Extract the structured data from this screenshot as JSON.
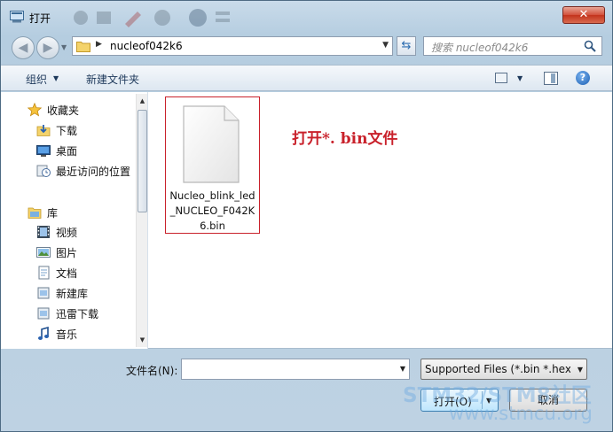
{
  "window": {
    "title": "打开",
    "close_label": "✕"
  },
  "navigation": {
    "address_path": "nucleof042k6",
    "search_placeholder": "搜索 nucleof042k6"
  },
  "toolbar": {
    "organize_label": "组织",
    "new_folder_label": "新建文件夹"
  },
  "sidebar": {
    "favorites_label": "收藏夹",
    "favorites": [
      {
        "label": "下载",
        "icon": "download-folder-icon"
      },
      {
        "label": "桌面",
        "icon": "desktop-icon"
      },
      {
        "label": "最近访问的位置",
        "icon": "recent-places-icon"
      }
    ],
    "libraries_label": "库",
    "libraries": [
      {
        "label": "视频",
        "icon": "video-library-icon"
      },
      {
        "label": "图片",
        "icon": "pictures-library-icon"
      },
      {
        "label": "文档",
        "icon": "documents-library-icon"
      },
      {
        "label": "新建库",
        "icon": "new-library-icon"
      },
      {
        "label": "迅雷下载",
        "icon": "thunder-download-icon"
      },
      {
        "label": "音乐",
        "icon": "music-library-icon"
      }
    ]
  },
  "files": [
    {
      "name": "Nucleo_blink_led_NUCLEO_F042K6.bin",
      "icon": "generic-file-icon",
      "selected": true
    }
  ],
  "annotation": "打开*. bin文件",
  "footer": {
    "filename_label": "文件名(N):",
    "filename_value": "",
    "filetype_value": "Supported Files (*.bin *.hex *",
    "open_label": "打开(O)",
    "cancel_label": "取消"
  },
  "watermark": {
    "line1": "STM32/STM8社区",
    "line2": "www.stmcu.org"
  },
  "colors": {
    "annotation": "#c9212b",
    "selection_border": "#c9212b",
    "chrome": "#c9dbea",
    "close_button": "#c3331c",
    "watermark": "#6eaae1"
  }
}
